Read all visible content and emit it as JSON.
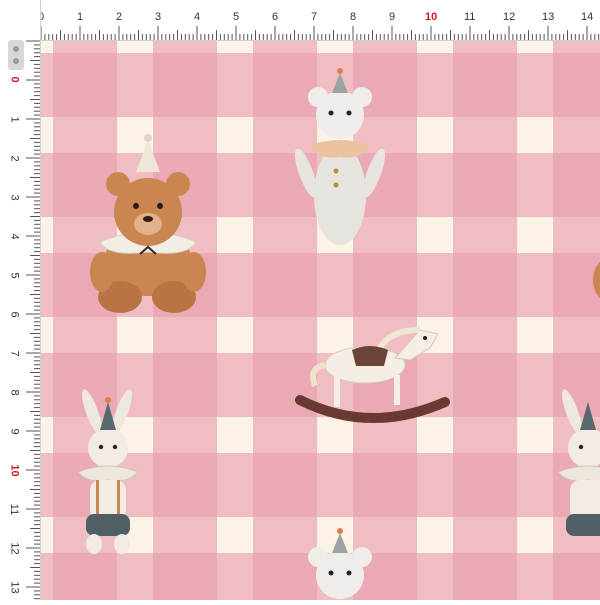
{
  "ruler": {
    "top_labels": [
      "0",
      "1",
      "2",
      "3",
      "4",
      "5",
      "6",
      "7",
      "8",
      "9",
      "10",
      "11",
      "12",
      "13",
      "14"
    ],
    "left_labels": [
      "0",
      "1",
      "2",
      "3",
      "4",
      "5",
      "6",
      "7",
      "8",
      "9",
      "10",
      "11",
      "12",
      "13"
    ],
    "highlight_label": "10"
  },
  "fabric": {
    "pattern": "gingham check",
    "colors": {
      "pink": "#e89dad",
      "cream": "#fbf3e6",
      "bear_brown": "#c98650",
      "horse_white": "#f4eee4",
      "rocker_brown": "#6a3a32",
      "bunny_shorts": "#4f5f64"
    },
    "motifs": [
      "teddy-bear",
      "stuffed-mouse",
      "rocking-horse",
      "stuffed-bunny"
    ]
  }
}
